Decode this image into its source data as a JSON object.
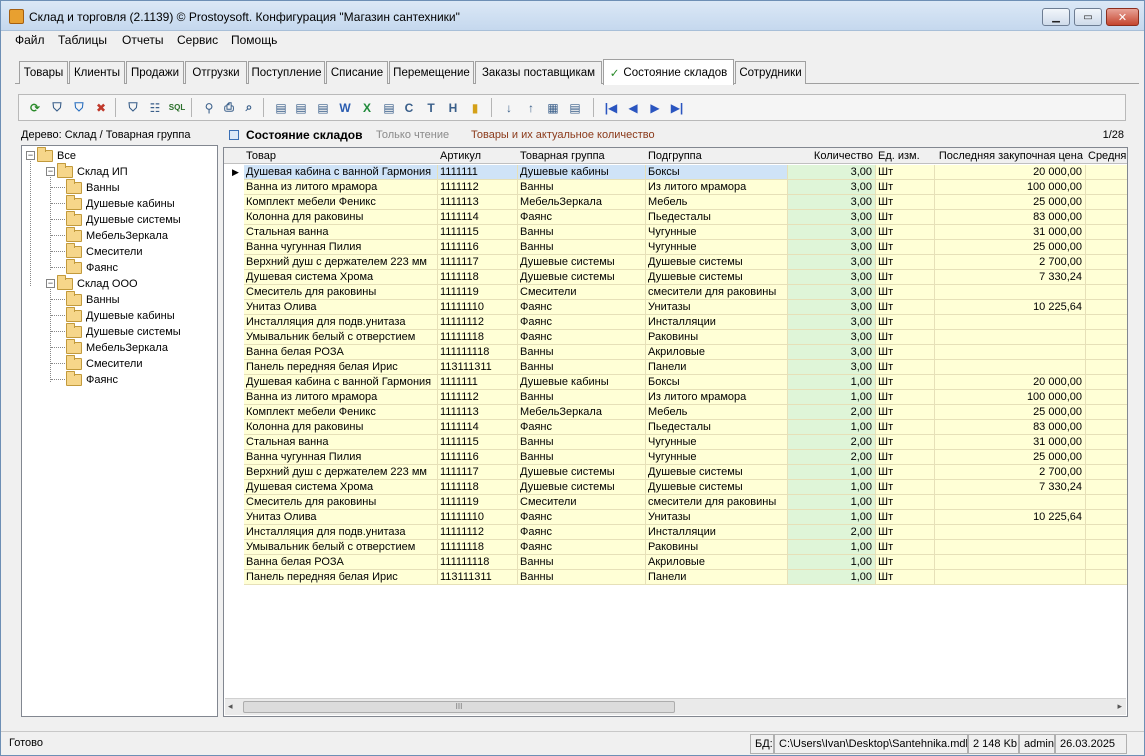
{
  "window": {
    "title": "Склад и торговля (2.1139) © Prostoysoft. Конфигурация \"Магазин сантехники\""
  },
  "menu": [
    "Файл",
    "Таблицы",
    "Отчеты",
    "Сервис",
    "Помощь"
  ],
  "tabs": [
    "Товары",
    "Клиенты",
    "Продажи",
    "Отгрузки",
    "Поступление",
    "Списание",
    "Перемещение",
    "Заказы поставщикам",
    "Состояние складов",
    "Сотрудники"
  ],
  "active_tab": "Состояние складов",
  "tree": {
    "label": "Дерево: Склад / Товарная группа",
    "root": "Все",
    "warehouses": [
      {
        "name": "Склад ИП",
        "groups": [
          "Ванны",
          "Душевые кабины",
          "Душевые системы",
          "МебельЗеркала",
          "Смесители",
          "Фаянс"
        ]
      },
      {
        "name": "Склад ООО",
        "groups": [
          "Ванны",
          "Душевые кабины",
          "Душевые системы",
          "МебельЗеркала",
          "Смесители",
          "Фаянс"
        ]
      }
    ]
  },
  "grid_header": {
    "title": "Состояние складов",
    "readonly": "Только чтение",
    "subtitle": "Товары и их актуальное количество",
    "page": "1/28"
  },
  "columns": [
    "Товар",
    "Артикул",
    "Товарная группа",
    "Подгруппа",
    "Количество",
    "Ед. изм.",
    "Последняя закупочная цена",
    "Средня"
  ],
  "rows": [
    [
      "Душевая кабина с ванной Гармония",
      "1111111",
      "Душевые кабины",
      "Боксы",
      "3,00",
      "Шт",
      "20 000,00"
    ],
    [
      "Ванна из литого мрамора",
      "1111112",
      "Ванны",
      "Из литого мрамора",
      "3,00",
      "Шт",
      "100 000,00"
    ],
    [
      "Комплект мебели Феникс",
      "1111113",
      "МебельЗеркала",
      "Мебель",
      "3,00",
      "Шт",
      "25 000,00"
    ],
    [
      "Колонна  для раковины",
      "1111114",
      "Фаянс",
      "Пьедесталы",
      "3,00",
      "Шт",
      "83 000,00"
    ],
    [
      "Стальная ванна",
      "1111115",
      "Ванны",
      "Чугунные",
      "3,00",
      "Шт",
      "31 000,00"
    ],
    [
      "Ванна чугунная Пилия",
      "1111116",
      "Ванны",
      "Чугунные",
      "3,00",
      "Шт",
      "25 000,00"
    ],
    [
      "Верхний душ с держателем 223 мм",
      "1111117",
      "Душевые системы",
      "Душевые системы",
      "3,00",
      "Шт",
      "2 700,00"
    ],
    [
      "Душевая система Хрома",
      "1111118",
      "Душевые системы",
      "Душевые системы",
      "3,00",
      "Шт",
      "7 330,24"
    ],
    [
      "Смеситель для раковины",
      "1111119",
      "Смесители",
      "смесители для раковины",
      "3,00",
      "Шт",
      ""
    ],
    [
      "Унитаз Олива",
      "11111110",
      "Фаянс",
      "Унитазы",
      "3,00",
      "Шт",
      "10 225,64"
    ],
    [
      "Инсталляция для подв.унитаза",
      "11111112",
      "Фаянс",
      "Инсталляции",
      "3,00",
      "Шт",
      ""
    ],
    [
      "Умывальник белый с отверстием",
      "11111118",
      "Фаянс",
      "Раковины",
      "3,00",
      "Шт",
      ""
    ],
    [
      "Ванна белая РОЗА",
      "111111118",
      "Ванны",
      "Акриловые",
      "3,00",
      "Шт",
      ""
    ],
    [
      "Панель передняя белая Ирис",
      "113111311",
      "Ванны",
      "Панели",
      "3,00",
      "Шт",
      ""
    ],
    [
      "Душевая кабина с ванной Гармония",
      "1111111",
      "Душевые кабины",
      "Боксы",
      "1,00",
      "Шт",
      "20 000,00"
    ],
    [
      "Ванна из литого мрамора",
      "1111112",
      "Ванны",
      "Из литого мрамора",
      "1,00",
      "Шт",
      "100 000,00"
    ],
    [
      "Комплект мебели Феникс",
      "1111113",
      "МебельЗеркала",
      "Мебель",
      "2,00",
      "Шт",
      "25 000,00"
    ],
    [
      "Колонна  для раковины",
      "1111114",
      "Фаянс",
      "Пьедесталы",
      "1,00",
      "Шт",
      "83 000,00"
    ],
    [
      "Стальная ванна",
      "1111115",
      "Ванны",
      "Чугунные",
      "2,00",
      "Шт",
      "31 000,00"
    ],
    [
      "Ванна чугунная Пилия",
      "1111116",
      "Ванны",
      "Чугунные",
      "2,00",
      "Шт",
      "25 000,00"
    ],
    [
      "Верхний душ с держателем 223 мм",
      "1111117",
      "Душевые системы",
      "Душевые системы",
      "1,00",
      "Шт",
      "2 700,00"
    ],
    [
      "Душевая система Хрома",
      "1111118",
      "Душевые системы",
      "Душевые системы",
      "1,00",
      "Шт",
      "7 330,24"
    ],
    [
      "Смеситель для раковины",
      "1111119",
      "Смесители",
      "смесители для раковины",
      "1,00",
      "Шт",
      ""
    ],
    [
      "Унитаз Олива",
      "11111110",
      "Фаянс",
      "Унитазы",
      "1,00",
      "Шт",
      "10 225,64"
    ],
    [
      "Инсталляция для подв.унитаза",
      "11111112",
      "Фаянс",
      "Инсталляции",
      "2,00",
      "Шт",
      ""
    ],
    [
      "Умывальник белый с отверстием",
      "11111118",
      "Фаянс",
      "Раковины",
      "1,00",
      "Шт",
      ""
    ],
    [
      "Ванна белая РОЗА",
      "111111118",
      "Ванны",
      "Акриловые",
      "1,00",
      "Шт",
      ""
    ],
    [
      "Панель передняя белая Ирис",
      "113111311",
      "Ванны",
      "Панели",
      "1,00",
      "Шт",
      ""
    ]
  ],
  "status": {
    "ready": "Готово",
    "db_label": "БД:",
    "db_path": "C:\\Users\\Ivan\\Desktop\\Santehnika.mdb",
    "db_size": "2 148 Kb",
    "user": "admin",
    "date": "26.03.2025"
  },
  "colors": {
    "row_bg": "#ffffd6",
    "qty_bg": "#dff5d8",
    "selected_bg": "#cfe3f7",
    "accent_text": "#8b3a1a"
  },
  "toolbar_icons": [
    "refresh-icon",
    "filter-icon",
    "filter-clear-icon",
    "filter-remove-icon",
    "filter-settings-icon",
    "tree-view-icon",
    "sql-icon",
    "find-icon",
    "print-icon",
    "preview-icon",
    "export-icon",
    "export-icon",
    "export-icon",
    "export-word-icon",
    "export-excel-icon",
    "export-icon",
    "export-csv-icon",
    "export-txt-icon",
    "export-html-icon",
    "chart-icon",
    "sort-asc-icon",
    "sort-desc-icon",
    "columns-icon",
    "settings-icon",
    "first-icon",
    "prev-icon",
    "next-icon",
    "last-icon"
  ]
}
